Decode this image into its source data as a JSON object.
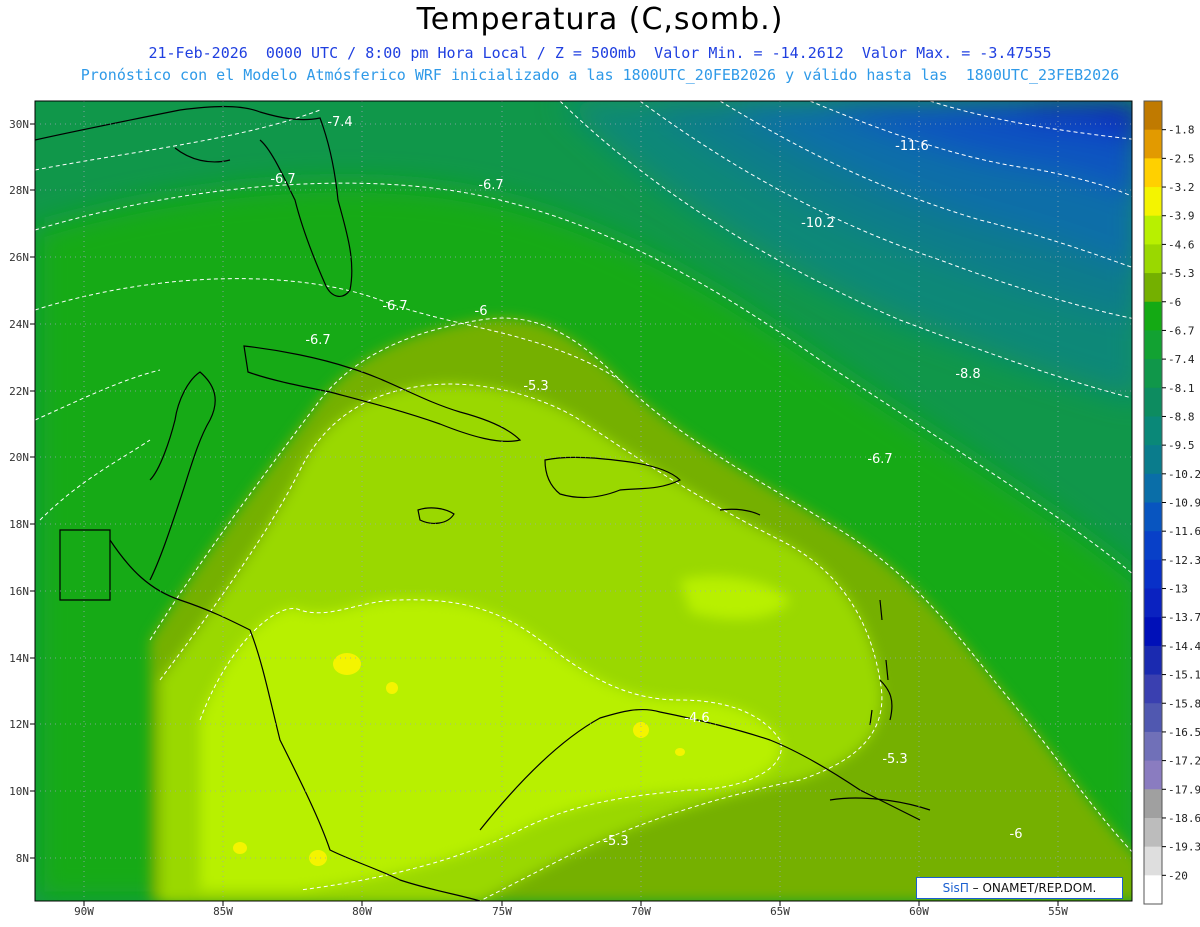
{
  "header": {
    "title": "Temperatura (C,somb.)",
    "line1": "21-Feb-2026  0000 UTC / 8:00 pm Hora Local / Z = 500mb  Valor Min. = -14.2612  Valor Max. = -3.47555",
    "line2": "Pronóstico con el Modelo Atmósferico WRF inicializado a las 1800UTC_20FEB2026 y válido hasta las  1800UTC_23FEB2026"
  },
  "axes": {
    "lon_labels": [
      "90W",
      "85W",
      "80W",
      "75W",
      "70W",
      "65W",
      "60W",
      "55W"
    ],
    "lat_labels": [
      "30N",
      "28N",
      "26N",
      "24N",
      "22N",
      "20N",
      "18N",
      "16N",
      "14N",
      "12N",
      "10N",
      "8N"
    ]
  },
  "colorbar": {
    "labels": [
      "-1.8",
      "-2.5",
      "-3.2",
      "-3.9",
      "-4.6",
      "-5.3",
      "-6",
      "-6.7",
      "-7.4",
      "-8.1",
      "-8.8",
      "-9.5",
      "-10.2",
      "-10.9",
      "-11.6",
      "-12.3",
      "-13",
      "-13.7",
      "-14.4",
      "-15.1",
      "-15.8",
      "-16.5",
      "-17.2",
      "-17.9",
      "-18.6",
      "-19.3",
      "-20"
    ],
    "colors": [
      "#c07a00",
      "#e29a00",
      "#ffd000",
      "#f4f400",
      "#b8f000",
      "#9ad800",
      "#74b000",
      "#14aa14",
      "#12a232",
      "#10974a",
      "#0d8c60",
      "#0a8878",
      "#0a7c8c",
      "#0a6ea8",
      "#0855c0",
      "#0840c8",
      "#0830c8",
      "#0a22c0",
      "#0010b8",
      "#1a2ab0",
      "#3a40b0",
      "#5058b0",
      "#7070b8",
      "#8a7cc0",
      "#a0a0a0",
      "#bcbcbc",
      "#dedede",
      "#ffffff"
    ]
  },
  "contour_labels": [
    {
      "text": "-7.4"
    },
    {
      "text": "-11.6"
    },
    {
      "text": "-6.7"
    },
    {
      "text": "-6.7"
    },
    {
      "text": "-10.2"
    },
    {
      "text": "-6.7"
    },
    {
      "text": "-6"
    },
    {
      "text": "-6.7"
    },
    {
      "text": "-5.3"
    },
    {
      "text": "-8.8"
    },
    {
      "text": "-6.7"
    },
    {
      "text": "-4.6"
    },
    {
      "text": "-5.3"
    },
    {
      "text": "-5.3"
    },
    {
      "text": "-6"
    }
  ],
  "credit": {
    "sis": "SisΠ",
    "rest": " – ONAMET/REP.DOM."
  }
}
